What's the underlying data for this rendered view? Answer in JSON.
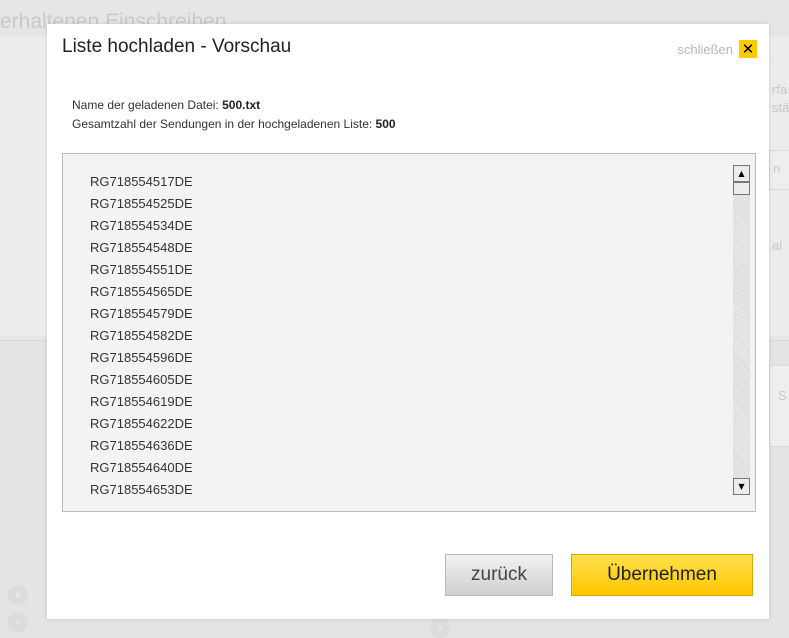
{
  "background": {
    "page_title": "erhaltenen Einschreiben",
    "side_texts": [
      "rfa",
      "stä",
      "n",
      "al",
      "S"
    ]
  },
  "dialog": {
    "title": "Liste hochladen - Vorschau",
    "close_label": "schließen",
    "close_icon": "✕",
    "file_label": "Name der geladenen Datei: ",
    "file_name": "500.txt",
    "count_label": "Gesamtzahl der Sendungen in der hochgeladenen Liste: ",
    "count_value": "500",
    "items": [
      "RG718554517DE",
      "RG718554525DE",
      "RG718554534DE",
      "RG718554548DE",
      "RG718554551DE",
      "RG718554565DE",
      "RG718554579DE",
      "RG718554582DE",
      "RG718554596DE",
      "RG718554605DE",
      "RG718554619DE",
      "RG718554622DE",
      "RG718554636DE",
      "RG718554640DE",
      "RG718554653DE"
    ],
    "back_label": "zurück",
    "apply_label": "Übernehmen"
  },
  "colors": {
    "accent": "#ffcc00",
    "overlay": "#e6e6e6"
  }
}
